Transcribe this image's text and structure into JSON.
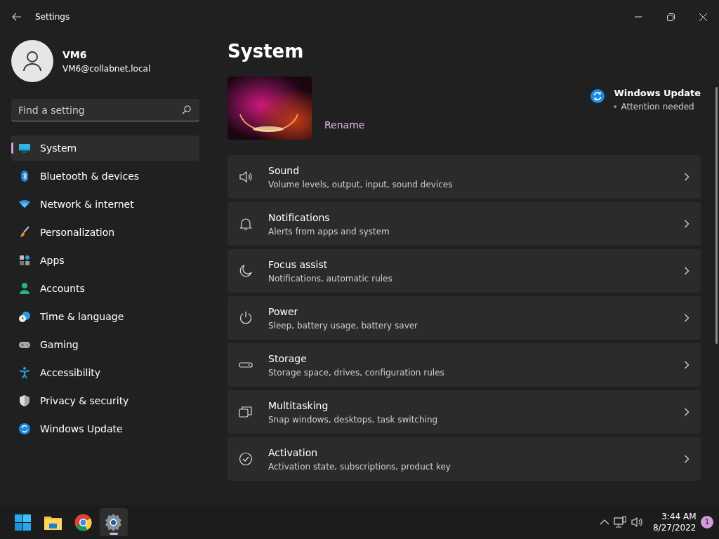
{
  "window": {
    "title": "Settings"
  },
  "user": {
    "name": "VM6",
    "email": "VM6@collabnet.local"
  },
  "search": {
    "placeholder": "Find a setting"
  },
  "nav": [
    {
      "label": "System",
      "selected": true
    },
    {
      "label": "Bluetooth & devices",
      "selected": false
    },
    {
      "label": "Network & internet",
      "selected": false
    },
    {
      "label": "Personalization",
      "selected": false
    },
    {
      "label": "Apps",
      "selected": false
    },
    {
      "label": "Accounts",
      "selected": false
    },
    {
      "label": "Time & language",
      "selected": false
    },
    {
      "label": "Gaming",
      "selected": false
    },
    {
      "label": "Accessibility",
      "selected": false
    },
    {
      "label": "Privacy & security",
      "selected": false
    },
    {
      "label": "Windows Update",
      "selected": false
    }
  ],
  "page": {
    "title": "System",
    "rename": "Rename",
    "update": {
      "title": "Windows Update",
      "status": "Attention needed"
    }
  },
  "settings": [
    {
      "title": "Sound",
      "subtitle": "Volume levels, output, input, sound devices"
    },
    {
      "title": "Notifications",
      "subtitle": "Alerts from apps and system"
    },
    {
      "title": "Focus assist",
      "subtitle": "Notifications, automatic rules"
    },
    {
      "title": "Power",
      "subtitle": "Sleep, battery usage, battery saver"
    },
    {
      "title": "Storage",
      "subtitle": "Storage space, drives, configuration rules"
    },
    {
      "title": "Multitasking",
      "subtitle": "Snap windows, desktops, task switching"
    },
    {
      "title": "Activation",
      "subtitle": "Activation state, subscriptions, product key"
    }
  ],
  "taskbar": {
    "apps": [
      {
        "selected": false
      },
      {
        "selected": false
      },
      {
        "selected": false
      },
      {
        "selected": true
      }
    ],
    "time": "3:44 AM",
    "date": "8/27/2022",
    "notifications": "1"
  }
}
